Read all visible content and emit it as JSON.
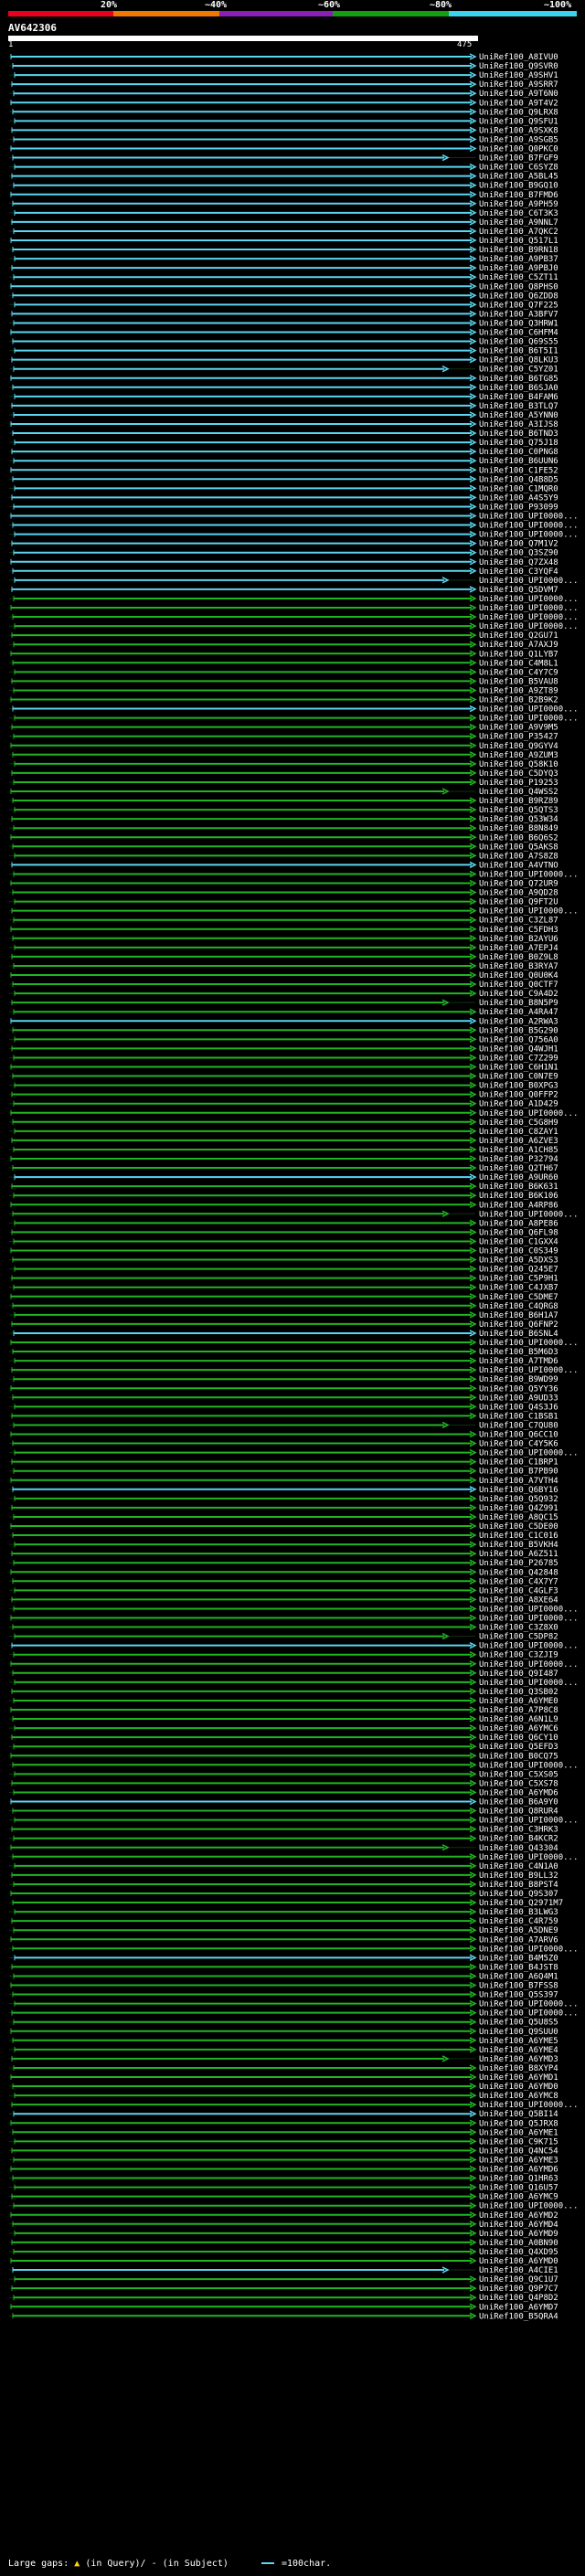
{
  "legend": {
    "labels": [
      "20%",
      "~40%",
      "~60%",
      "~80%",
      "~100%"
    ],
    "colors": [
      "#e8001c",
      "#f07800",
      "#8a1fb4",
      "#159e11",
      "#3bd3ef"
    ]
  },
  "query_id": "AV642306",
  "ruler": {
    "start": "1",
    "end": "475"
  },
  "colors": {
    "cyan": "#5bd6f0",
    "green": "#22b522",
    "dim_line": "#1f4a1f",
    "ruler": "#ffffff"
  },
  "hits": [
    "UniRef100_A8IVU0",
    "UniRef100_Q9SVR0",
    "UniRef100_A9SHV1",
    "UniRef100_A9SRR7",
    "UniRef100_A9T6N0",
    "UniRef100_A9T4V2",
    "UniRef100_Q9LRX8",
    "UniRef100_Q9SFU1",
    "UniRef100_A9SXK8",
    "UniRef100_A9SGB5",
    "UniRef100_Q0PKC0",
    "UniRef100_B7FGF9",
    "UniRef100_C6SYZ8",
    "UniRef100_A5BL45",
    "UniRef100_B9GQ10",
    "UniRef100_B7FMD6",
    "UniRef100_A9PH59",
    "UniRef100_C6T3K3",
    "UniRef100_A9NNL7",
    "UniRef100_A7QKC2",
    "UniRef100_Q517L1",
    "UniRef100_B9RN18",
    "UniRef100_A9PB37",
    "UniRef100_A9PBJ0",
    "UniRef100_C5ZT11",
    "UniRef100_Q8PHS0",
    "UniRef100_Q6ZDD8",
    "UniRef100_Q7F225",
    "UniRef100_A3BFV7",
    "UniRef100_Q3HRW1",
    "UniRef100_C6HFM4",
    "UniRef100_Q69S55",
    "UniRef100_B6T5I1",
    "UniRef100_Q8LKU3",
    "UniRef100_C5YZ01",
    "UniRef100_B6TG85",
    "UniRef100_B6SJA0",
    "UniRef100_B4FAM6",
    "UniRef100_B3TLQ7",
    "UniRef100_A5YNN0",
    "UniRef100_A3IJS8",
    "UniRef100_B6TND3",
    "UniRef100_Q75J18",
    "UniRef100_C0PNG8",
    "UniRef100_B6UUN6",
    "UniRef100_C1FE52",
    "UniRef100_Q4B8D5",
    "UniRef100_C1MQR0",
    "UniRef100_A4S5Y9",
    "UniRef100_P93099",
    "UniRef100_UPI0000...",
    "UniRef100_UPI0000...",
    "UniRef100_UPI0000...",
    "UniRef100_Q7M1V2",
    "UniRef100_Q3SZ90",
    "UniRef100_Q7ZX48",
    "UniRef100_C3YQF4",
    "UniRef100_UPI0000...",
    "UniRef100_Q5DVM7",
    "UniRef100_UPI0000...",
    "UniRef100_UPI0000...",
    "UniRef100_UPI0000...",
    "UniRef100_UPI0000...",
    "UniRef100_Q2GU71",
    "UniRef100_A7AXJ9",
    "UniRef100_Q1LYB7",
    "UniRef100_C4M8L1",
    "UniRef100_C4Y7C9",
    "UniRef100_B5VAU8",
    "UniRef100_A9ZT89",
    "UniRef100_B2B9K2",
    "UniRef100_UPI0000...",
    "UniRef100_UPI0000...",
    "UniRef100_A9V9M5",
    "UniRef100_P35427",
    "UniRef100_Q9GYV4",
    "UniRef100_A9ZUM3",
    "UniRef100_Q58K10",
    "UniRef100_C5DYQ3",
    "UniRef100_P19253",
    "UniRef100_Q4WSS2",
    "UniRef100_B9RZ89",
    "UniRef100_Q5QTS3",
    "UniRef100_Q53W34",
    "UniRef100_B8N849",
    "UniRef100_B6Q6S2",
    "UniRef100_Q5AKS8",
    "UniRef100_A7S8Z8",
    "UniRef100_A4VTNO",
    "UniRef100_UPI0000...",
    "UniRef100_Q72UR9",
    "UniRef100_A9QD28",
    "UniRef100_Q9FT2U",
    "UniRef100_UPI0000...",
    "UniRef100_C3ZL87",
    "UniRef100_C5FDH3",
    "UniRef100_B2AYU6",
    "UniRef100_A7EPJ4",
    "UniRef100_B0Z9L8",
    "UniRef100_B3RYA7",
    "UniRef100_Q0U0K4",
    "UniRef100_Q0CTF7",
    "UniRef100_C9A4D2",
    "UniRef100_B8N5P9",
    "UniRef100_A4RA47",
    "UniRef100_A2RWA3",
    "UniRef100_B5G290",
    "UniRef100_Q756A0",
    "UniRef100_Q4WJH1",
    "UniRef100_C7Z299",
    "UniRef100_C6H1N1",
    "UniRef100_C0N7E9",
    "UniRef100_B0XPG3",
    "UniRef100_Q0FFP2",
    "UniRef100_A1D429",
    "UniRef100_UPI0000...",
    "UniRef100_C5G8H9",
    "UniRef100_C8ZAY1",
    "UniRef100_A6ZVE3",
    "UniRef100_A1CH85",
    "UniRef100_P32794",
    "UniRef100_Q2TH67",
    "UniRef100_A9UR60",
    "UniRef100_B6K631",
    "UniRef100_B6K106",
    "UniRef100_A4RP86",
    "UniRef100_UPI0000...",
    "UniRef100_A8PE86",
    "UniRef100_Q6FL98",
    "UniRef100_C1GXX4",
    "UniRef100_C0S349",
    "UniRef100_A5DXS3",
    "UniRef100_Q245E7",
    "UniRef100_C5P9H1",
    "UniRef100_C4JXB7",
    "UniRef100_C5DME7",
    "UniRef100_C4QRG8",
    "UniRef100_B6H1A7",
    "UniRef100_Q6FNP2",
    "UniRef100_B6SNL4",
    "UniRef100_UPI0000...",
    "UniRef100_B5M6D3",
    "UniRef100_A7TMD6",
    "UniRef100_UPI0000...",
    "UniRef100_B9WD99",
    "UniRef100_Q5YY36",
    "UniRef100_A9UD33",
    "UniRef100_Q4S3J6",
    "UniRef100_C1BSB1",
    "UniRef100_C7QU80",
    "UniRef100_Q6CC10",
    "UniRef100_C4Y5K6",
    "UniRef100_UPI0000...",
    "UniRef100_C1BRP1",
    "UniRef100_B7PB90",
    "UniRef100_A7VTH4",
    "UniRef100_Q6BY16",
    "UniRef100_Q5Q932",
    "UniRef100_Q4Z991",
    "UniRef100_A8QC15",
    "UniRef100_C5DE00",
    "UniRef100_C1C016",
    "UniRef100_B5VKH4",
    "UniRef100_A6Z511",
    "UniRef100_P26785",
    "UniRef100_Q42848",
    "UniRef100_C4X7Y7",
    "UniRef100_C4GLF3",
    "UniRef100_A8XE64",
    "UniRef100_UPI0000...",
    "UniRef100_UPI0000...",
    "UniRef100_C3Z8X0",
    "UniRef100_C5DP82",
    "UniRef100_UPI0000...",
    "UniRef100_C3ZJI9",
    "UniRef100_UPI0000...",
    "UniRef100_Q9I487",
    "UniRef100_UPI0000...",
    "UniRef100_Q3SB02",
    "UniRef100_A6YME0",
    "UniRef100_A7P8C8",
    "UniRef100_A6N1L9",
    "UniRef100_A6YMC6",
    "UniRef100_Q6CY10",
    "UniRef100_Q5EFD3",
    "UniRef100_B0CQ75",
    "UniRef100_UPI0000...",
    "UniRef100_C5XS05",
    "UniRef100_C5XS78",
    "UniRef100_A6YMD6",
    "UniRef100_B6A9Y0",
    "UniRef100_Q8RUR4",
    "UniRef100_UPI0000...",
    "UniRef100_C3HRK3",
    "UniRef100_B4KCR2",
    "UniRef100_Q43304",
    "UniRef100_UPI0000...",
    "UniRef100_C4N1A0",
    "UniRef100_B9LL32",
    "UniRef100_B8PST4",
    "UniRef100_Q9S307",
    "UniRef100_Q2971M7",
    "UniRef100_B3LWG3",
    "UniRef100_C4R759",
    "UniRef100_A5DNE9",
    "UniRef100_A7ARV6",
    "UniRef100_UPI0000...",
    "UniRef100_B4M5Z0",
    "UniRef100_B4JST8",
    "UniRef100_A6Q4M1",
    "UniRef100_B7FSS8",
    "UniRef100_Q5S397",
    "UniRef100_UPI0000...",
    "UniRef100_UPI0000...",
    "UniRef100_Q5U8S5",
    "UniRef100_Q9SUU0",
    "UniRef100_A6YME5",
    "UniRef100_A6YME4",
    "UniRef100_A6YMD3",
    "UniRef100_B8XYP4",
    "UniRef100_A6YMD1",
    "UniRef100_A6YMD0",
    "UniRef100_A6YMC8",
    "UniRef100_UPI0000...",
    "UniRef100_Q5BI14",
    "UniRef100_Q5JRX8",
    "UniRef100_A6YME1",
    "UniRef100_C9K715",
    "UniRef100_Q4NC54",
    "UniRef100_A6YME3",
    "UniRef100_A6YMD6",
    "UniRef100_Q1HR63",
    "UniRef100_Q16U57",
    "UniRef100_A6YMC9",
    "UniRef100_UPI0000...",
    "UniRef100_A6YMD2",
    "UniRef100_A6YMD4",
    "UniRef100_A6YMD9",
    "UniRef100_A0BN90",
    "UniRef100_Q4XD95",
    "UniRef100_A6YMD0",
    "UniRef100_A4CIE1",
    "UniRef100_Q9C1U7",
    "UniRef100_Q9P7C7",
    "UniRef100_Q4P8D2",
    "UniRef100_A6YMD7",
    "UniRef100_B5QRA4"
  ],
  "footer": {
    "large_gaps": "Large gaps:",
    "in_query": "(in Query)/",
    "in_subject": "(in Subject)",
    "scale": "=100char."
  }
}
